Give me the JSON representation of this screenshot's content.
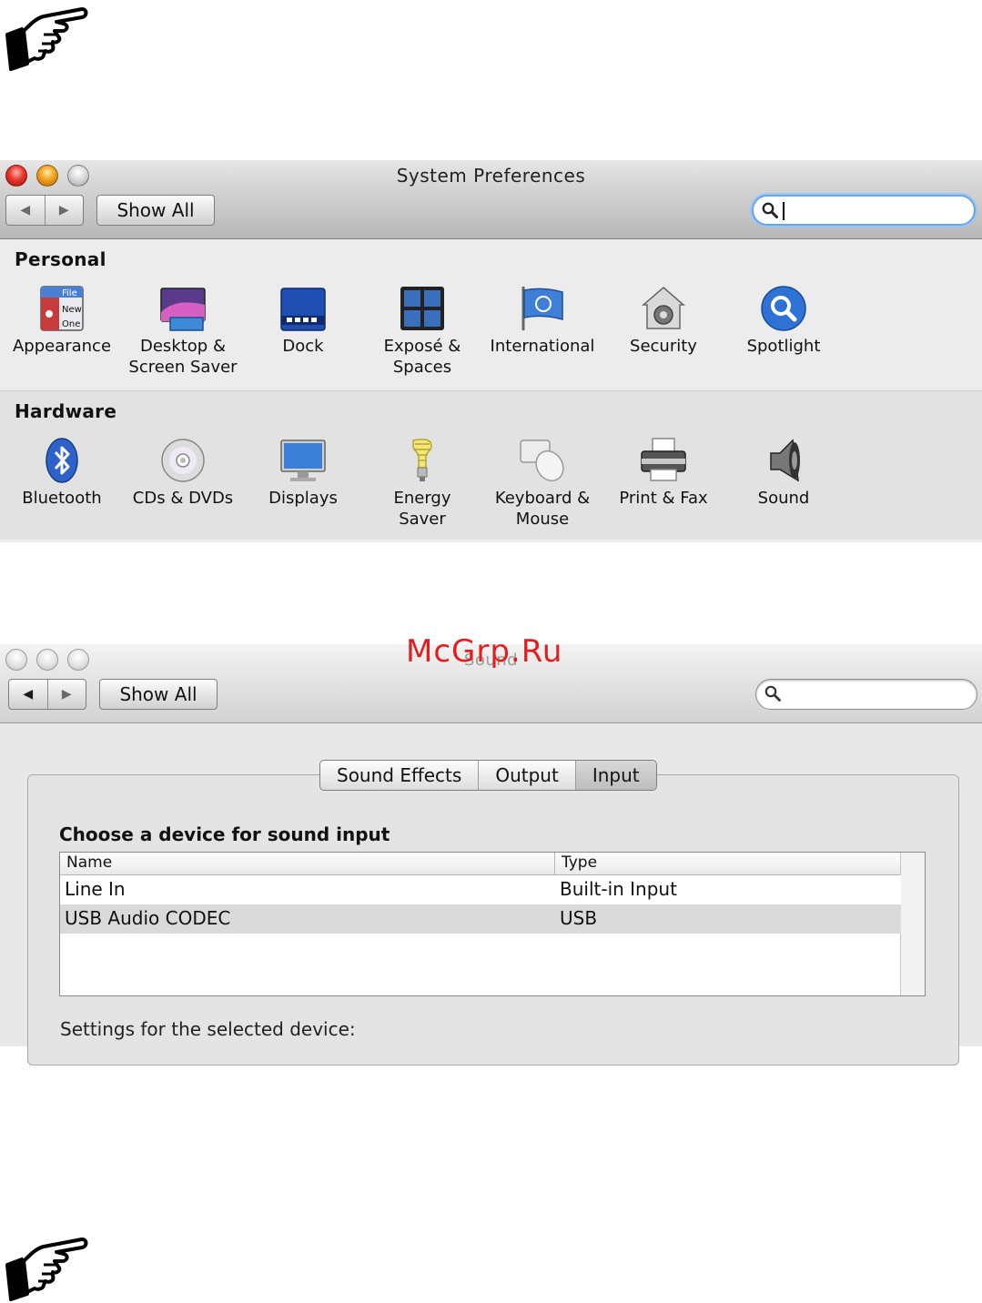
{
  "watermark": "McGrp.Ru",
  "window1": {
    "title": "System Preferences",
    "show_all": "Show All",
    "nav_back": "◀",
    "nav_forward": "▶",
    "search_value": "",
    "sections": [
      {
        "title": "Personal",
        "items": [
          {
            "label": "Appearance",
            "icon": "appearance-icon"
          },
          {
            "label": "Desktop &\nScreen Saver",
            "icon": "desktop-icon"
          },
          {
            "label": "Dock",
            "icon": "dock-icon"
          },
          {
            "label": "Exposé &\nSpaces",
            "icon": "expose-icon"
          },
          {
            "label": "International",
            "icon": "international-icon"
          },
          {
            "label": "Security",
            "icon": "security-icon"
          },
          {
            "label": "Spotlight",
            "icon": "spotlight-icon"
          }
        ]
      },
      {
        "title": "Hardware",
        "items": [
          {
            "label": "Bluetooth",
            "icon": "bluetooth-icon"
          },
          {
            "label": "CDs & DVDs",
            "icon": "cd-icon"
          },
          {
            "label": "Displays",
            "icon": "display-icon"
          },
          {
            "label": "Energy\nSaver",
            "icon": "bulb-icon"
          },
          {
            "label": "Keyboard &\nMouse",
            "icon": "mouse-icon"
          },
          {
            "label": "Print & Fax",
            "icon": "printer-icon"
          },
          {
            "label": "Sound",
            "icon": "speaker-icon"
          }
        ]
      }
    ],
    "appearance_icon_text": [
      "File",
      "New",
      "One"
    ]
  },
  "window2": {
    "title": "Sound",
    "show_all": "Show All",
    "nav_back": "◀",
    "nav_forward": "▶",
    "tabs": [
      "Sound Effects",
      "Output",
      "Input"
    ],
    "selected_tab": "Input",
    "heading": "Choose a device for sound input",
    "columns": [
      "Name",
      "Type"
    ],
    "rows": [
      {
        "name": "Line In",
        "type": "Built-in Input"
      },
      {
        "name": "USB Audio CODEC",
        "type": "USB"
      }
    ],
    "settings_label": "Settings for the selected device:"
  }
}
